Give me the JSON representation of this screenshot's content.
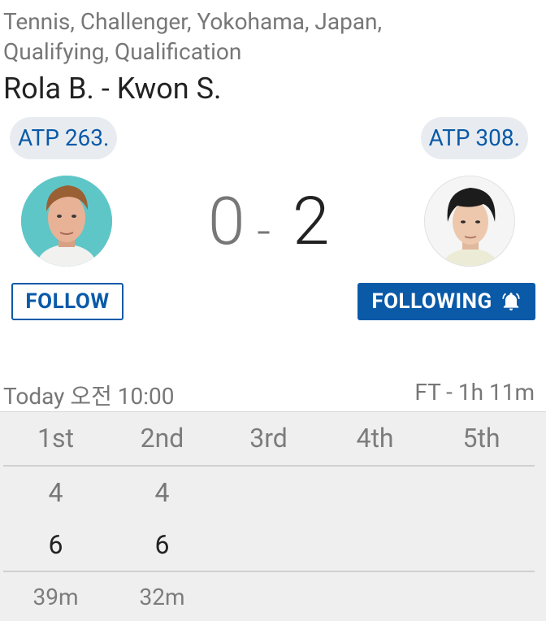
{
  "match": {
    "breadcrumb": "Tennis, Challenger, Yokohama, Japan, Qualifying, Qualification",
    "title": "Rola B. - Kwon S.",
    "home": {
      "rank": "ATP 263.",
      "follow_label": "FOLLOW"
    },
    "away": {
      "rank": "ATP 308.",
      "follow_label": "FOLLOWING"
    },
    "score": {
      "home": "0",
      "separator": "-",
      "away": "2"
    },
    "start_time": "Today 오전 10:00",
    "status": "FT - 1h 11m"
  },
  "sets": {
    "headers": [
      "1st",
      "2nd",
      "3rd",
      "4th",
      "5th"
    ],
    "home": [
      "4",
      "4",
      "",
      "",
      ""
    ],
    "away": [
      "6",
      "6",
      "",
      "",
      ""
    ],
    "durations": [
      "39m",
      "32m",
      "",
      "",
      ""
    ]
  },
  "colors": {
    "accent": "#0a5aa8",
    "pill_bg": "#e8ecf0",
    "table_bg": "#efefef"
  },
  "icons": {
    "bell": "bell-icon"
  }
}
